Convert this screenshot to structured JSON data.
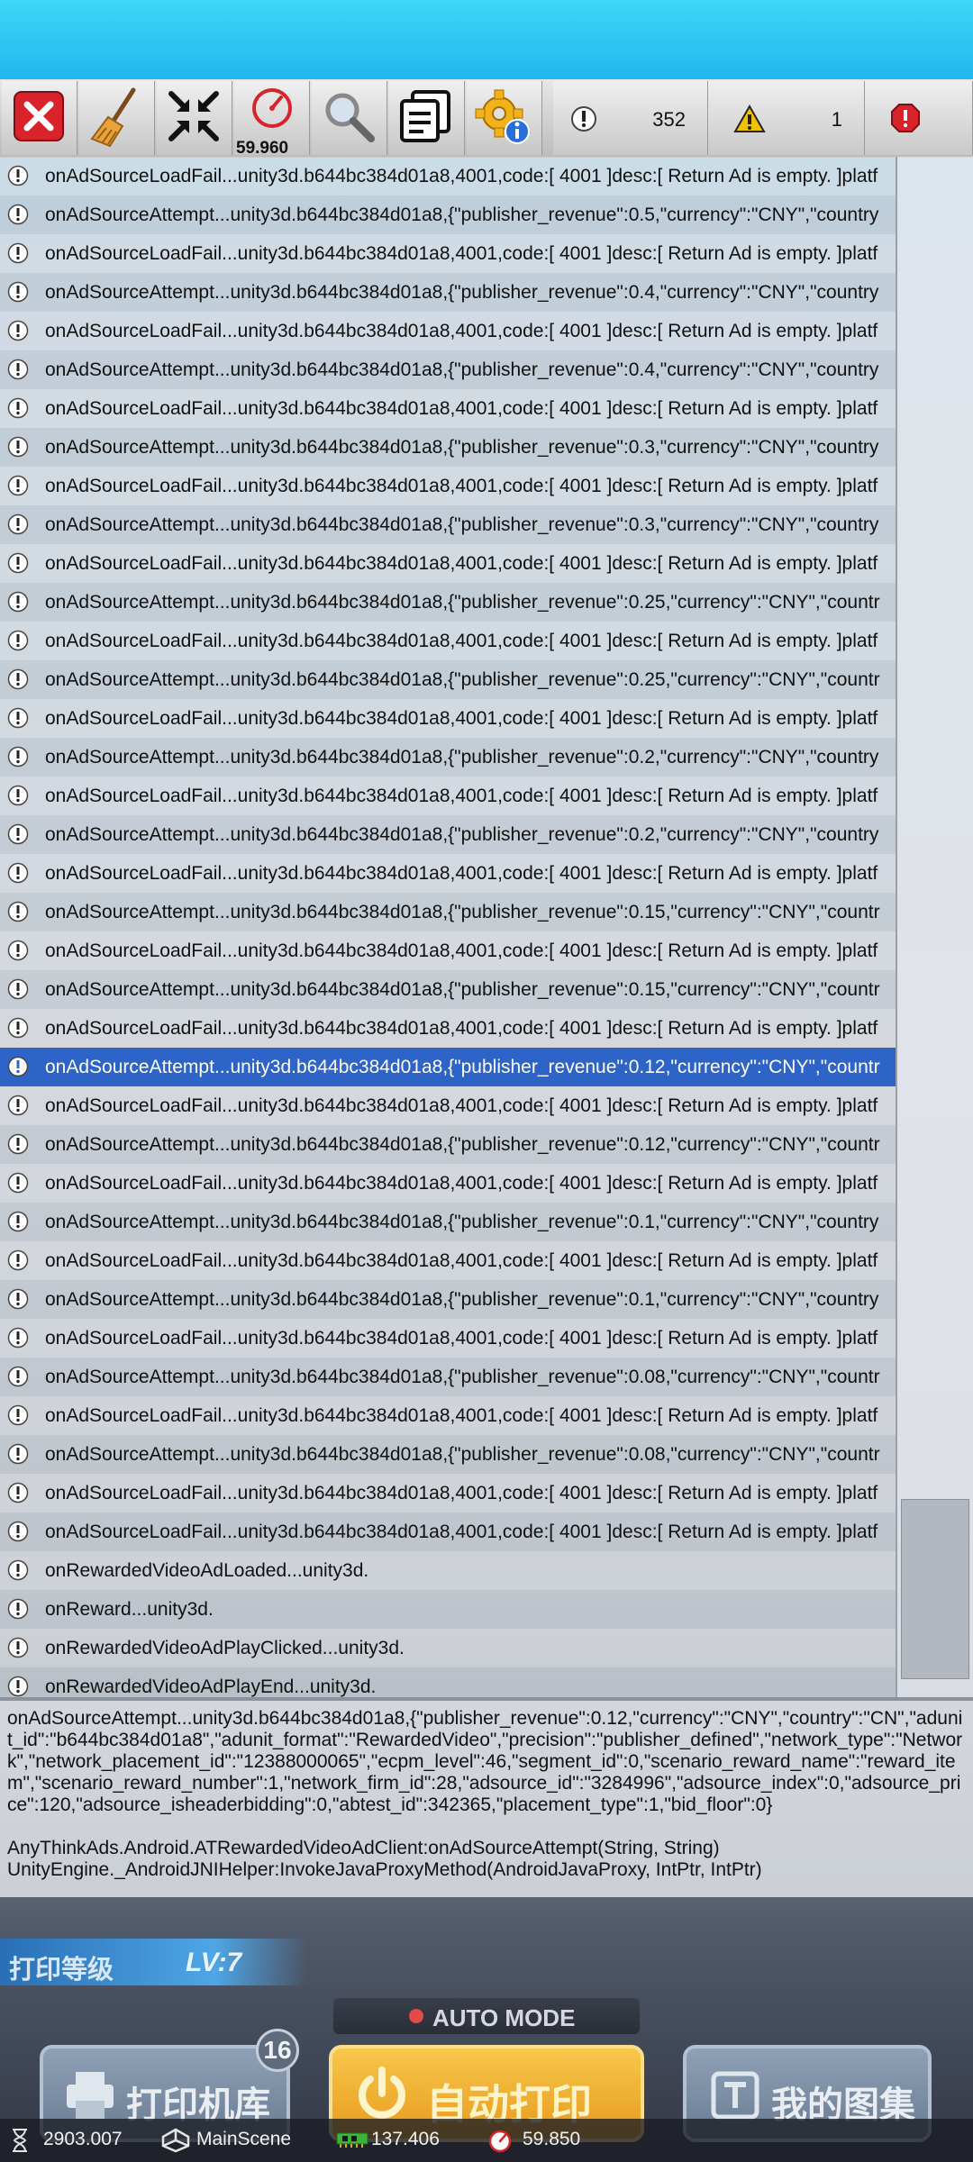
{
  "toolbar": {
    "fps": "59.960",
    "log_count": "352",
    "warning_count": "1",
    "error_count": ""
  },
  "logs": [
    {
      "text": "onAdSourceLoadFail...unity3d.b644bc384d01a8,4001,code:[ 4001 ]desc:[ Return Ad is empty. ]platf"
    },
    {
      "text": "onAdSourceAttempt...unity3d.b644bc384d01a8,{\"publisher_revenue\":0.5,\"currency\":\"CNY\",\"country"
    },
    {
      "text": "onAdSourceLoadFail...unity3d.b644bc384d01a8,4001,code:[ 4001 ]desc:[ Return Ad is empty. ]platf"
    },
    {
      "text": "onAdSourceAttempt...unity3d.b644bc384d01a8,{\"publisher_revenue\":0.4,\"currency\":\"CNY\",\"country"
    },
    {
      "text": "onAdSourceLoadFail...unity3d.b644bc384d01a8,4001,code:[ 4001 ]desc:[ Return Ad is empty. ]platf"
    },
    {
      "text": "onAdSourceAttempt...unity3d.b644bc384d01a8,{\"publisher_revenue\":0.4,\"currency\":\"CNY\",\"country"
    },
    {
      "text": "onAdSourceLoadFail...unity3d.b644bc384d01a8,4001,code:[ 4001 ]desc:[ Return Ad is empty. ]platf"
    },
    {
      "text": "onAdSourceAttempt...unity3d.b644bc384d01a8,{\"publisher_revenue\":0.3,\"currency\":\"CNY\",\"country"
    },
    {
      "text": "onAdSourceLoadFail...unity3d.b644bc384d01a8,4001,code:[ 4001 ]desc:[ Return Ad is empty. ]platf"
    },
    {
      "text": "onAdSourceAttempt...unity3d.b644bc384d01a8,{\"publisher_revenue\":0.3,\"currency\":\"CNY\",\"country"
    },
    {
      "text": "onAdSourceLoadFail...unity3d.b644bc384d01a8,4001,code:[ 4001 ]desc:[ Return Ad is empty. ]platf"
    },
    {
      "text": "onAdSourceAttempt...unity3d.b644bc384d01a8,{\"publisher_revenue\":0.25,\"currency\":\"CNY\",\"countr"
    },
    {
      "text": "onAdSourceLoadFail...unity3d.b644bc384d01a8,4001,code:[ 4001 ]desc:[ Return Ad is empty. ]platf"
    },
    {
      "text": "onAdSourceAttempt...unity3d.b644bc384d01a8,{\"publisher_revenue\":0.25,\"currency\":\"CNY\",\"countr"
    },
    {
      "text": "onAdSourceLoadFail...unity3d.b644bc384d01a8,4001,code:[ 4001 ]desc:[ Return Ad is empty. ]platf"
    },
    {
      "text": "onAdSourceAttempt...unity3d.b644bc384d01a8,{\"publisher_revenue\":0.2,\"currency\":\"CNY\",\"country"
    },
    {
      "text": "onAdSourceLoadFail...unity3d.b644bc384d01a8,4001,code:[ 4001 ]desc:[ Return Ad is empty. ]platf"
    },
    {
      "text": "onAdSourceAttempt...unity3d.b644bc384d01a8,{\"publisher_revenue\":0.2,\"currency\":\"CNY\",\"country"
    },
    {
      "text": "onAdSourceLoadFail...unity3d.b644bc384d01a8,4001,code:[ 4001 ]desc:[ Return Ad is empty. ]platf"
    },
    {
      "text": "onAdSourceAttempt...unity3d.b644bc384d01a8,{\"publisher_revenue\":0.15,\"currency\":\"CNY\",\"countr"
    },
    {
      "text": "onAdSourceLoadFail...unity3d.b644bc384d01a8,4001,code:[ 4001 ]desc:[ Return Ad is empty. ]platf"
    },
    {
      "text": "onAdSourceAttempt...unity3d.b644bc384d01a8,{\"publisher_revenue\":0.15,\"currency\":\"CNY\",\"countr"
    },
    {
      "text": "onAdSourceLoadFail...unity3d.b644bc384d01a8,4001,code:[ 4001 ]desc:[ Return Ad is empty. ]platf"
    },
    {
      "text": "onAdSourceAttempt...unity3d.b644bc384d01a8,{\"publisher_revenue\":0.12,\"currency\":\"CNY\",\"countr",
      "selected": true
    },
    {
      "text": "onAdSourceLoadFail...unity3d.b644bc384d01a8,4001,code:[ 4001 ]desc:[ Return Ad is empty. ]platf"
    },
    {
      "text": "onAdSourceAttempt...unity3d.b644bc384d01a8,{\"publisher_revenue\":0.12,\"currency\":\"CNY\",\"countr"
    },
    {
      "text": "onAdSourceLoadFail...unity3d.b644bc384d01a8,4001,code:[ 4001 ]desc:[ Return Ad is empty. ]platf"
    },
    {
      "text": "onAdSourceAttempt...unity3d.b644bc384d01a8,{\"publisher_revenue\":0.1,\"currency\":\"CNY\",\"country"
    },
    {
      "text": "onAdSourceLoadFail...unity3d.b644bc384d01a8,4001,code:[ 4001 ]desc:[ Return Ad is empty. ]platf"
    },
    {
      "text": "onAdSourceAttempt...unity3d.b644bc384d01a8,{\"publisher_revenue\":0.1,\"currency\":\"CNY\",\"country"
    },
    {
      "text": "onAdSourceLoadFail...unity3d.b644bc384d01a8,4001,code:[ 4001 ]desc:[ Return Ad is empty. ]platf"
    },
    {
      "text": "onAdSourceAttempt...unity3d.b644bc384d01a8,{\"publisher_revenue\":0.08,\"currency\":\"CNY\",\"countr"
    },
    {
      "text": "onAdSourceLoadFail...unity3d.b644bc384d01a8,4001,code:[ 4001 ]desc:[ Return Ad is empty. ]platf"
    },
    {
      "text": "onAdSourceAttempt...unity3d.b644bc384d01a8,{\"publisher_revenue\":0.08,\"currency\":\"CNY\",\"countr"
    },
    {
      "text": "onAdSourceLoadFail...unity3d.b644bc384d01a8,4001,code:[ 4001 ]desc:[ Return Ad is empty. ]platf"
    },
    {
      "text": "onAdSourceLoadFail...unity3d.b644bc384d01a8,4001,code:[ 4001 ]desc:[ Return Ad is empty. ]platf"
    },
    {
      "text": "onRewardedVideoAdLoaded...unity3d."
    },
    {
      "text": "onReward...unity3d."
    },
    {
      "text": "onRewardedVideoAdPlayClicked...unity3d."
    },
    {
      "text": "onRewardedVideoAdPlayEnd...unity3d."
    }
  ],
  "detail": {
    "message": "onAdSourceAttempt...unity3d.b644bc384d01a8,{\"publisher_revenue\":0.12,\"currency\":\"CNY\",\"country\":\"CN\",\"adunit_id\":\"b644bc384d01a8\",\"adunit_format\":\"RewardedVideo\",\"precision\":\"publisher_defined\",\"network_type\":\"Network\",\"network_placement_id\":\"12388000065\",\"ecpm_level\":46,\"segment_id\":0,\"scenario_reward_name\":\"reward_item\",\"scenario_reward_number\":1,\"network_firm_id\":28,\"adsource_id\":\"3284996\",\"adsource_index\":0,\"adsource_price\":120,\"adsource_isheaderbidding\":0,\"abtest_id\":342365,\"placement_type\":1,\"bid_floor\":0}",
    "stacktrace": "AnyThinkAds.Android.ATRewardedVideoAdClient:onAdSourceAttempt(String, String)\nUnityEngine._AndroidJNIHelper:InvokeJavaProxyMethod(AndroidJavaProxy, IntPtr, IntPtr)"
  },
  "game": {
    "print_level_label": "打印等级",
    "print_level_value": "LV:7",
    "auto_mode_label": "AUTO MODE",
    "printer_library_label": "打印机库",
    "printer_library_badge": "16",
    "auto_print_label": "自动打印",
    "gallery_label": "我的图集"
  },
  "stats": {
    "time": "2903.007",
    "scene": "MainScene",
    "memory": "137.406",
    "fps": "59.850"
  },
  "colors": {
    "selected_row": "#2e64c8",
    "close_button": "#d9232b",
    "error_badge": "#d9232b",
    "warning_badge": "#f2c200"
  }
}
